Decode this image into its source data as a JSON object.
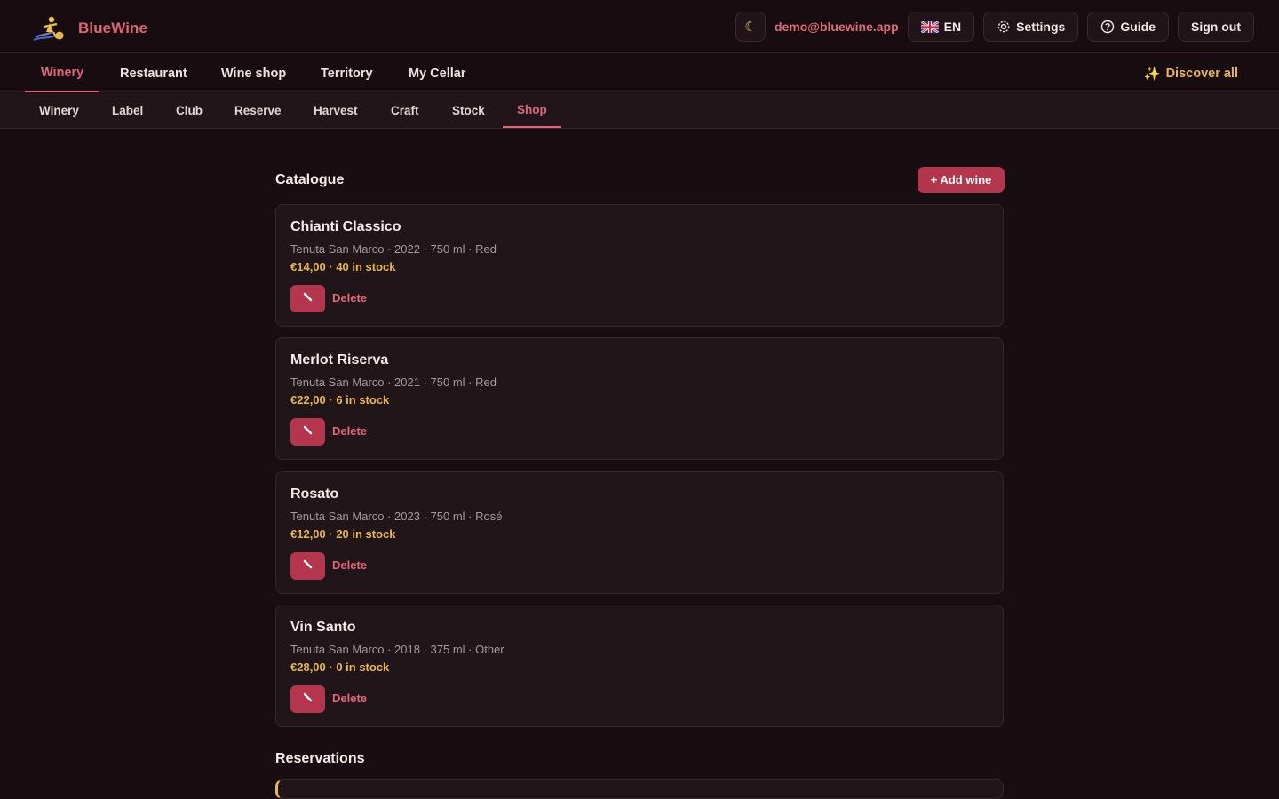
{
  "app": {
    "name": "BlueWine"
  },
  "topbar": {
    "theme_icon": "moon-icon",
    "email": "demo@bluewine.app",
    "language": "EN",
    "settings_label": "Settings",
    "guide_label": "Guide",
    "signout_label": "Sign out"
  },
  "nav_primary": {
    "items": [
      "Winery",
      "Restaurant",
      "Wine shop",
      "Territory",
      "My Cellar"
    ],
    "active": "Winery",
    "discover_label": "Discover all"
  },
  "nav_secondary": {
    "items": [
      "Winery",
      "Label",
      "Club",
      "Reserve",
      "Harvest",
      "Craft",
      "Stock",
      "Shop"
    ],
    "active": "Shop"
  },
  "catalogue": {
    "title": "Catalogue",
    "add_label": "+ Add wine",
    "wines": [
      {
        "name": "Chianti Classico",
        "meta": "Tenuta San Marco · 2022 · 750 ml · Red",
        "price_stock": "€14,00 · 40 in stock",
        "delete_label": "Delete"
      },
      {
        "name": "Merlot Riserva",
        "meta": "Tenuta San Marco · 2021 · 750 ml · Red",
        "price_stock": "€22,00 · 6 in stock",
        "delete_label": "Delete"
      },
      {
        "name": "Rosato",
        "meta": "Tenuta San Marco · 2023 · 750 ml · Rosé",
        "price_stock": "€12,00 · 20 in stock",
        "delete_label": "Delete"
      },
      {
        "name": "Vin Santo",
        "meta": "Tenuta San Marco · 2018 · 375 ml · Other",
        "price_stock": "€28,00 · 0 in stock",
        "delete_label": "Delete"
      }
    ]
  },
  "reservations": {
    "title": "Reservations"
  },
  "colors": {
    "accent": "#e06678",
    "button": "#b4364d",
    "gold": "#e9b654",
    "background": "#180d10"
  }
}
